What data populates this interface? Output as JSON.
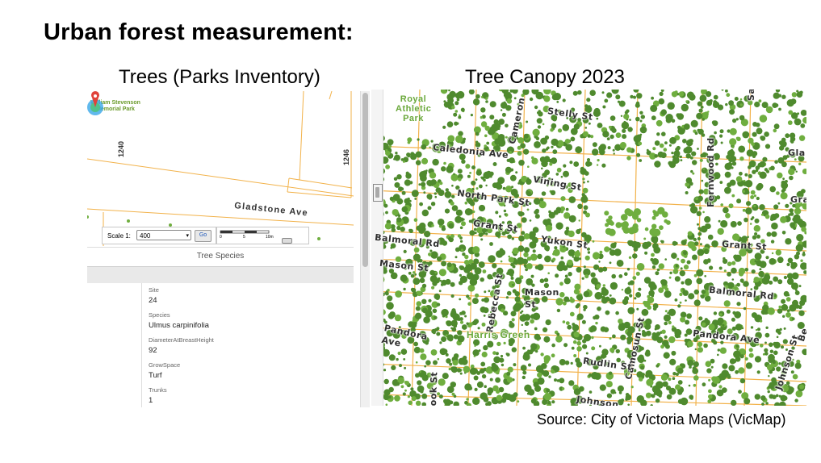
{
  "slide": {
    "title": "Urban forest measurement:",
    "left_subtitle": "Trees (Parks Inventory)",
    "right_subtitle": "Tree Canopy 2023",
    "source": "Source: City of Victoria Maps (VicMap)"
  },
  "inventory": {
    "park_label": "William Stevenson Memorial Park",
    "street_numbers": [
      "1240",
      "1246"
    ],
    "street_name": "Gladstone Ave",
    "marker_icon": "map-pin-icon",
    "scale": {
      "label": "Scale 1:",
      "value": "400",
      "go_label": "Go",
      "ruler_ticks": [
        "0",
        "5",
        "10m"
      ]
    },
    "tab_label": "Tree Species",
    "attributes": [
      {
        "key": "Site",
        "value": "24"
      },
      {
        "key": "Species",
        "value": "Ulmus carpinifolia"
      },
      {
        "key": "DiameterAtBreastHeight",
        "value": "92"
      },
      {
        "key": "GrowSpace",
        "value": "Turf"
      },
      {
        "key": "Trunks",
        "value": "1"
      }
    ]
  },
  "canopy": {
    "park_label": "Royal Athletic Park",
    "green_label": "Harris Green",
    "streets": [
      "Stelly St",
      "Cameron",
      "Caledonia Ave",
      "Vining St",
      "North Park St",
      "Grant St",
      "Yukon St",
      "Balmoral Rd",
      "Mason St",
      "Mason St",
      "Rebecca St",
      "Pandora Ave",
      "Camosun St",
      "Rudlin St",
      "Fernwood Rd",
      "Grant St",
      "Balmoral Rd",
      "Pandora Ave",
      "Johnson St",
      "Johnson",
      "ook St",
      "Gla",
      "Gra",
      "Be",
      "Sa"
    ],
    "colors": {
      "canopy": "#4f8a2e",
      "canopy_light": "#6fae3f",
      "road": "#f2b24a"
    }
  }
}
